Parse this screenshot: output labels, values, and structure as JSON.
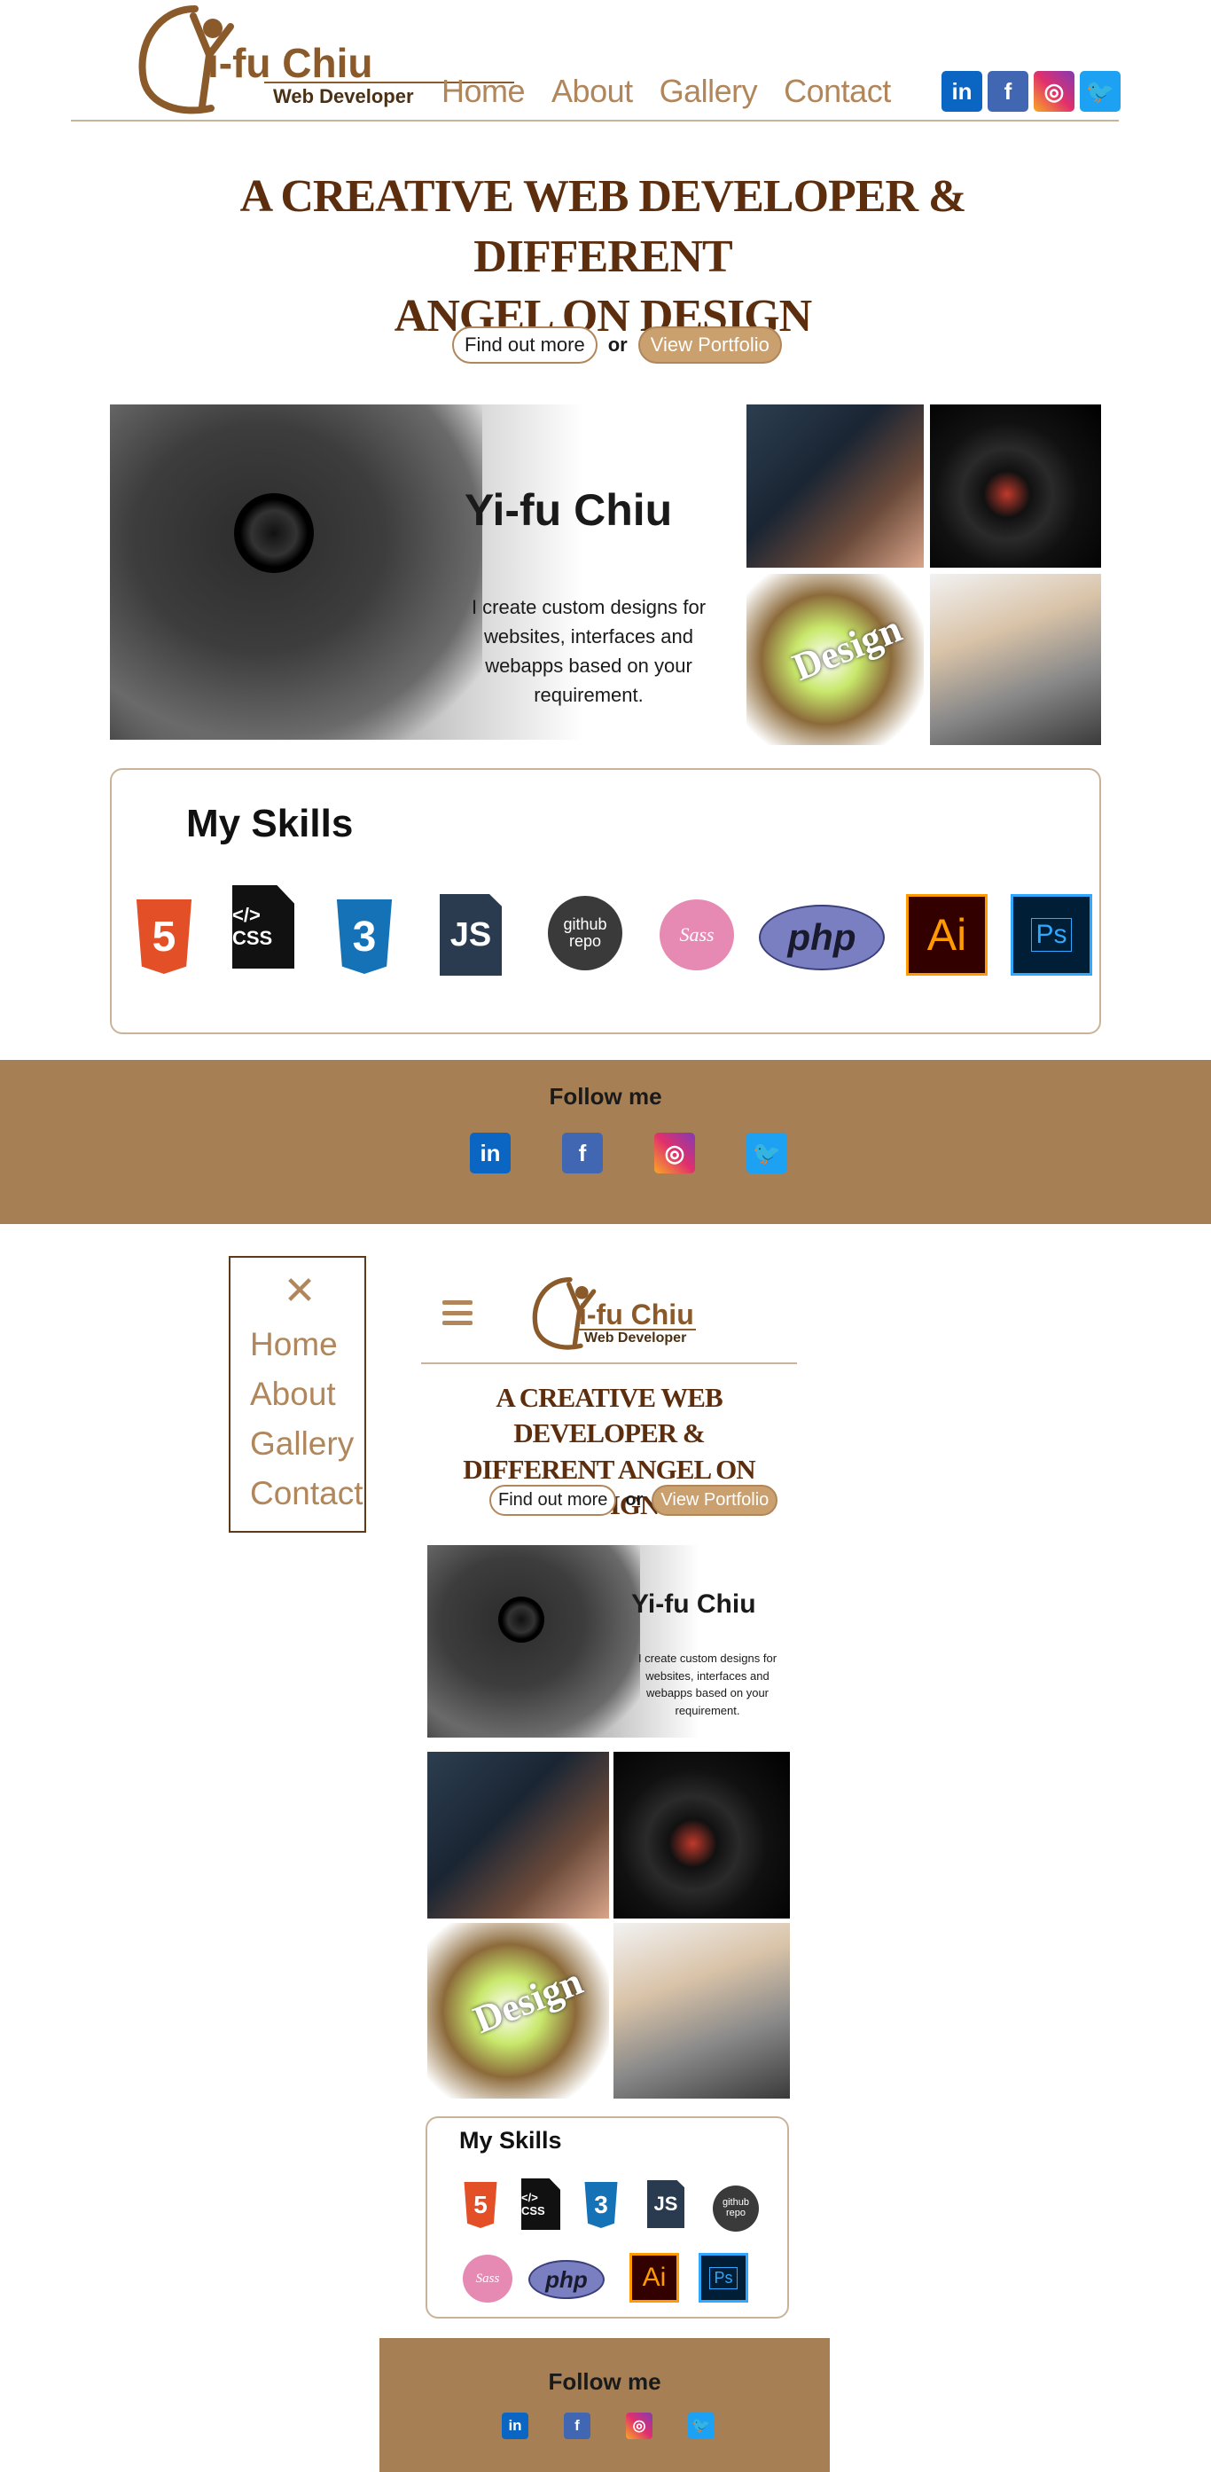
{
  "brand": {
    "name": "i-fu Chiu",
    "initial": "Y",
    "tagline": "Web Developer"
  },
  "nav": {
    "items": [
      "Home",
      "About",
      "Gallery",
      "Contact"
    ]
  },
  "social": {
    "linkedin": "in",
    "facebook": "f",
    "instagram": "◎",
    "twitter": "🐦"
  },
  "hero": {
    "title_line1": "A CREATIVE WEB DEVELOPER & DIFFERENT",
    "title_line2": "ANGEL ON DESIGN",
    "title_mobile_line1": "A CREATIVE WEB DEVELOPER &",
    "title_mobile_line2": "DIFFERENT ANGEL ON DESIGN",
    "find_out_more": "Find out more",
    "or": "or",
    "view_portfolio": "View Portfolio"
  },
  "banner": {
    "name": "Yi-fu Chiu",
    "description": "I create custom designs for websites, interfaces and webapps based on your requirement."
  },
  "gallery": {
    "design_label": "Design"
  },
  "skills": {
    "title": "My Skills",
    "items": [
      {
        "name": "HTML5",
        "label": "5",
        "caption": "HTML5"
      },
      {
        "name": "CSS",
        "label": "</> CSS"
      },
      {
        "name": "CSS3",
        "label": "3",
        "caption": "CSS3"
      },
      {
        "name": "JavaScript",
        "label": "JS",
        "caption": "JAVASCRIPT"
      },
      {
        "name": "GitHub",
        "label": "github repo"
      },
      {
        "name": "Sass",
        "label": "Sass"
      },
      {
        "name": "PHP",
        "label": "php"
      },
      {
        "name": "Illustrator",
        "label": "Ai"
      },
      {
        "name": "Photoshop",
        "label": "Ps"
      }
    ]
  },
  "footer": {
    "title": "Follow me"
  },
  "mobile_menu": {
    "close": "✕",
    "items": [
      "Home",
      "About",
      "Gallery",
      "Contact"
    ]
  },
  "colors": {
    "brand_brown": "#8b5a2b",
    "nav_tan": "#b0865a",
    "footer_bg": "#a67f55",
    "title_dark": "#5c2e0e"
  }
}
